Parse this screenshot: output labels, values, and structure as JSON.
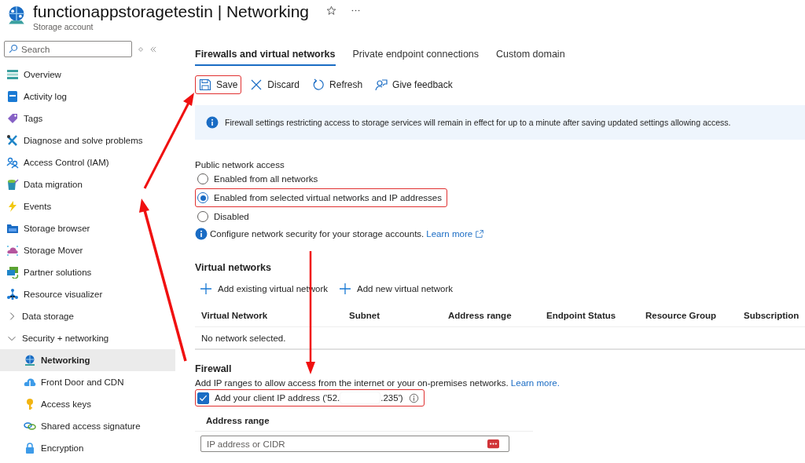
{
  "header": {
    "title": "functionappstoragetestin | Networking",
    "subtitle": "Storage account"
  },
  "sidebar": {
    "search": {
      "placeholder": "Search"
    },
    "items": [
      {
        "label": "Overview",
        "selected": false
      },
      {
        "label": "Activity log",
        "selected": false
      },
      {
        "label": "Tags",
        "selected": false
      },
      {
        "label": "Diagnose and solve problems",
        "selected": false
      },
      {
        "label": "Access Control (IAM)",
        "selected": false
      },
      {
        "label": "Data migration",
        "selected": false
      },
      {
        "label": "Events",
        "selected": false
      },
      {
        "label": "Storage browser",
        "selected": false
      },
      {
        "label": "Storage Mover",
        "selected": false
      },
      {
        "label": "Partner solutions",
        "selected": false
      },
      {
        "label": "Resource visualizer",
        "selected": false
      },
      {
        "label": "Data storage",
        "selected": false,
        "expanded": false
      },
      {
        "label": "Security + networking",
        "selected": false,
        "expanded": true,
        "children": [
          {
            "label": "Networking",
            "selected": true
          },
          {
            "label": "Front Door and CDN",
            "selected": false
          },
          {
            "label": "Access keys",
            "selected": false
          },
          {
            "label": "Shared access signature",
            "selected": false
          },
          {
            "label": "Encryption",
            "selected": false
          }
        ]
      }
    ]
  },
  "tabs": [
    {
      "label": "Firewalls and virtual networks",
      "selected": true
    },
    {
      "label": "Private endpoint connections",
      "selected": false
    },
    {
      "label": "Custom domain",
      "selected": false
    }
  ],
  "toolbar": [
    {
      "label": "Save",
      "highlighted": true
    },
    {
      "label": "Discard",
      "highlighted": false
    },
    {
      "label": "Refresh",
      "highlighted": false
    },
    {
      "label": "Give feedback",
      "highlighted": false
    }
  ],
  "banner": "Firewall settings restricting access to storage services will remain in effect for up to a minute after saving updated settings allowing access.",
  "public_access": {
    "label": "Public network access",
    "options": [
      {
        "label": "Enabled from all networks",
        "selected": false,
        "highlighted": false
      },
      {
        "label": "Enabled from selected virtual networks and IP addresses",
        "selected": true,
        "highlighted": true
      },
      {
        "label": "Disabled",
        "selected": false,
        "highlighted": false
      }
    ],
    "info": "Configure network security for your storage accounts.",
    "link": "Learn more"
  },
  "virtual_networks": {
    "heading": "Virtual networks",
    "actions": [
      "Add existing virtual network",
      "Add new virtual network"
    ],
    "columns": [
      "Virtual Network",
      "Subnet",
      "Address range",
      "Endpoint Status",
      "Resource Group",
      "Subscription"
    ],
    "empty": "No network selected."
  },
  "firewall": {
    "heading": "Firewall",
    "description": "Add IP ranges to allow access from the internet or your on-premises networks.",
    "link": "Learn more.",
    "client_ip": {
      "label_start": "Add your client IP address ('52.",
      "label_end": ".235')",
      "checked": true,
      "highlighted": true
    },
    "column": "Address range",
    "input": {
      "placeholder": "IP address or CIDR"
    }
  }
}
